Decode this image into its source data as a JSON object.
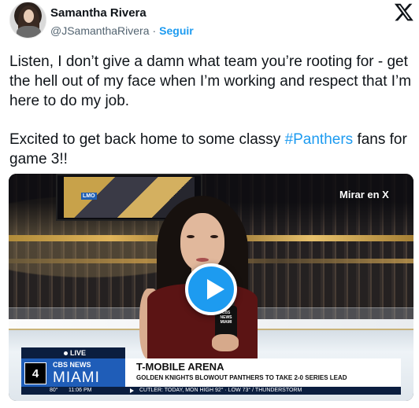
{
  "author": {
    "display_name": "Samantha Rivera",
    "handle": "@JSamanthaRivera",
    "separator": "·",
    "follow_label": "Seguir"
  },
  "tweet": {
    "paragraph1": "Listen, I don’t give a damn what team you’re rooting for - get the hell out of my face when I’m working and respect that I’m here to do my job.",
    "paragraph2_before": "Excited to get back home to some classy ",
    "hashtag": "#Panthers",
    "paragraph2_after": " fans for game 3!!"
  },
  "media": {
    "watch_on_x_label": "Mirar en X",
    "jumbotron_tag": "LMO",
    "mic_label": "CBS NEWS MIAMI",
    "lower_third": {
      "live_label": "LIVE",
      "station_number": "4",
      "network": "CBS NEWS",
      "city": "MIAMI",
      "headline": "T-MOBILE ARENA",
      "subheadline": "GOLDEN KNIGHTS BLOWOUT PANTHERS TO TAKE 2-0 SERIES LEAD",
      "temperature": "80°",
      "time": "11:06 PM",
      "weather": "CUTLER: TODAY, MON HIGH 92° · LOW 73° / THUNDERSTORM"
    }
  },
  "icons": {
    "x_logo": "x-logo-icon",
    "play": "play-icon"
  },
  "colors": {
    "link": "#1d9bf0",
    "text": "#0f1419",
    "muted": "#536471"
  }
}
